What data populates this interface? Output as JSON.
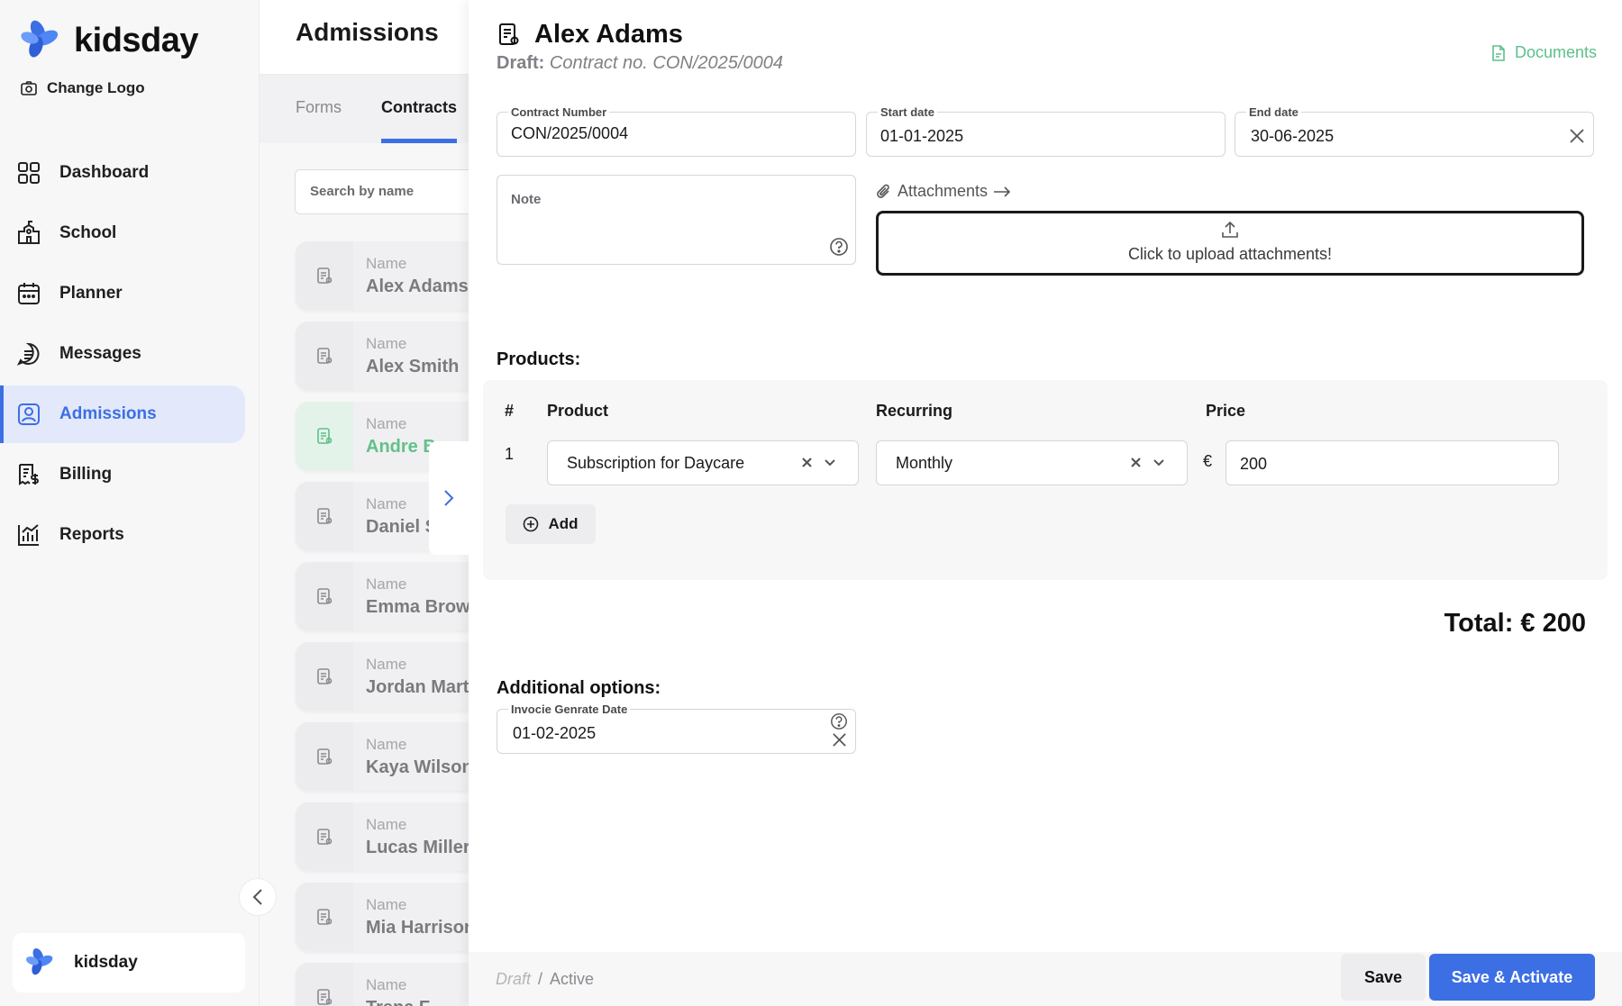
{
  "app": {
    "brand": "kidsday",
    "change_logo": "Change Logo",
    "org_name": "kidsday"
  },
  "sidebar": {
    "items": [
      {
        "label": "Dashboard",
        "icon": "grid-icon"
      },
      {
        "label": "School",
        "icon": "school-icon"
      },
      {
        "label": "Planner",
        "icon": "calendar-icon"
      },
      {
        "label": "Messages",
        "icon": "message-icon"
      },
      {
        "label": "Admissions",
        "icon": "user-badge-icon",
        "active": true
      },
      {
        "label": "Billing",
        "icon": "billing-icon"
      },
      {
        "label": "Reports",
        "icon": "chart-icon"
      }
    ]
  },
  "list": {
    "title": "Admissions",
    "tabs": [
      {
        "label": "Forms"
      },
      {
        "label": "Contracts",
        "active": true
      }
    ],
    "search_placeholder": "Search by name",
    "name_label": "Name",
    "records": [
      {
        "label": "Name",
        "name": "Alex Adams"
      },
      {
        "label": "Name",
        "name": "Alex Smith"
      },
      {
        "label": "Name",
        "name": "Andre Brown",
        "selected": true
      },
      {
        "label": "Name",
        "name": "Daniel Smith"
      },
      {
        "label": "Name",
        "name": "Emma Brown"
      },
      {
        "label": "Name",
        "name": "Jordan Martin"
      },
      {
        "label": "Name",
        "name": "Kaya Wilson"
      },
      {
        "label": "Name",
        "name": "Lucas Miller"
      },
      {
        "label": "Name",
        "name": "Mia Harrison"
      },
      {
        "label": "Name",
        "name": "Trena F"
      }
    ]
  },
  "detail": {
    "title": "Alex Adams",
    "status_prefix": "Draft:",
    "contract_caption": "Contract no. CON/2025/0004",
    "documents_label": "Documents",
    "contract_number": {
      "label": "Contract Number",
      "value": "CON/2025/0004"
    },
    "start_date": {
      "label": "Start date",
      "value": "01-01-2025"
    },
    "end_date": {
      "label": "End date",
      "value": "30-06-2025"
    },
    "note": {
      "label": "Note",
      "value": ""
    },
    "attachments_label": "Attachments",
    "upload_text": "Click to upload attachments!",
    "products": {
      "title": "Products:",
      "headers": {
        "num": "#",
        "product": "Product",
        "recurring": "Recurring",
        "price": "Price"
      },
      "rows": [
        {
          "num": "1",
          "product": "Subscription for Daycare",
          "recurring": "Monthly",
          "currency": "€",
          "price": "200"
        }
      ],
      "add_label": "Add"
    },
    "total": "Total: € 200",
    "additional_options": {
      "title": "Additional options:",
      "invoice_date": {
        "label": "Invocie Genrate Date",
        "value": "01-02-2025"
      }
    },
    "footer": {
      "status_draft": "Draft",
      "status_sep": "/",
      "status_active": "Active",
      "save_label": "Save",
      "activate_label": "Save & Activate"
    }
  },
  "colors": {
    "accent": "#3c6fe4",
    "success": "#5cc08a",
    "active_nav_bg": "#e3e9fb"
  }
}
